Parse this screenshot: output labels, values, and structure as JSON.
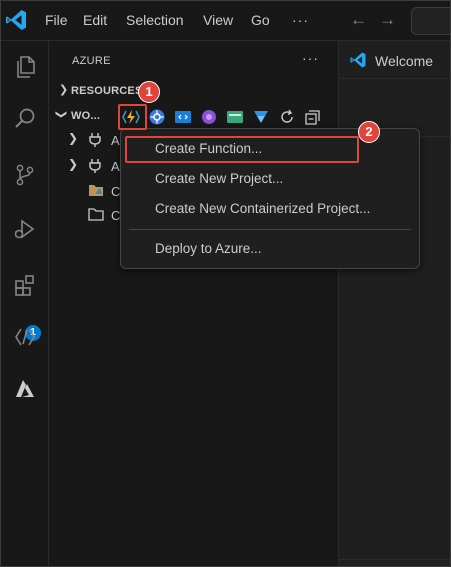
{
  "menu": {
    "file": "File",
    "edit": "Edit",
    "selection": "Selection",
    "view": "View",
    "go": "Go",
    "more": "···"
  },
  "nav": {
    "back": "←",
    "forward": "→"
  },
  "activity_bar": {
    "items": [
      "explorer-icon",
      "search-icon",
      "source-control-icon",
      "run-debug-icon",
      "extensions-icon",
      "remote-icon",
      "azure-icon"
    ],
    "extensions_badge": "1"
  },
  "sidebar": {
    "title": "AZURE",
    "more": "···",
    "resources_section": "RESOURCES",
    "workspace_section": "WO...",
    "tree": [
      {
        "label": "A",
        "icon": "plug-icon"
      },
      {
        "label": "A",
        "icon": "plug-icon"
      },
      {
        "label": "C",
        "icon": "folder-azure-icon"
      },
      {
        "label": "C",
        "icon": "folder-icon"
      }
    ],
    "toolbar": [
      "azure-functions-icon",
      "kubernetes-icon",
      "static-web-apps-icon",
      "logic-apps-icon",
      "app-service-icon",
      "storage-icon",
      "refresh-icon",
      "collapse-all-icon"
    ]
  },
  "editor": {
    "tab_label": "Welcome"
  },
  "context_menu": {
    "items": [
      "Create Function...",
      "Create New Project...",
      "Create New Containerized Project...",
      "Deploy to Azure..."
    ]
  },
  "callouts": {
    "step1": "1",
    "step2": "2"
  },
  "colors": {
    "accent": "#0078d4",
    "callout": "#e0443b",
    "background": "#181818"
  }
}
